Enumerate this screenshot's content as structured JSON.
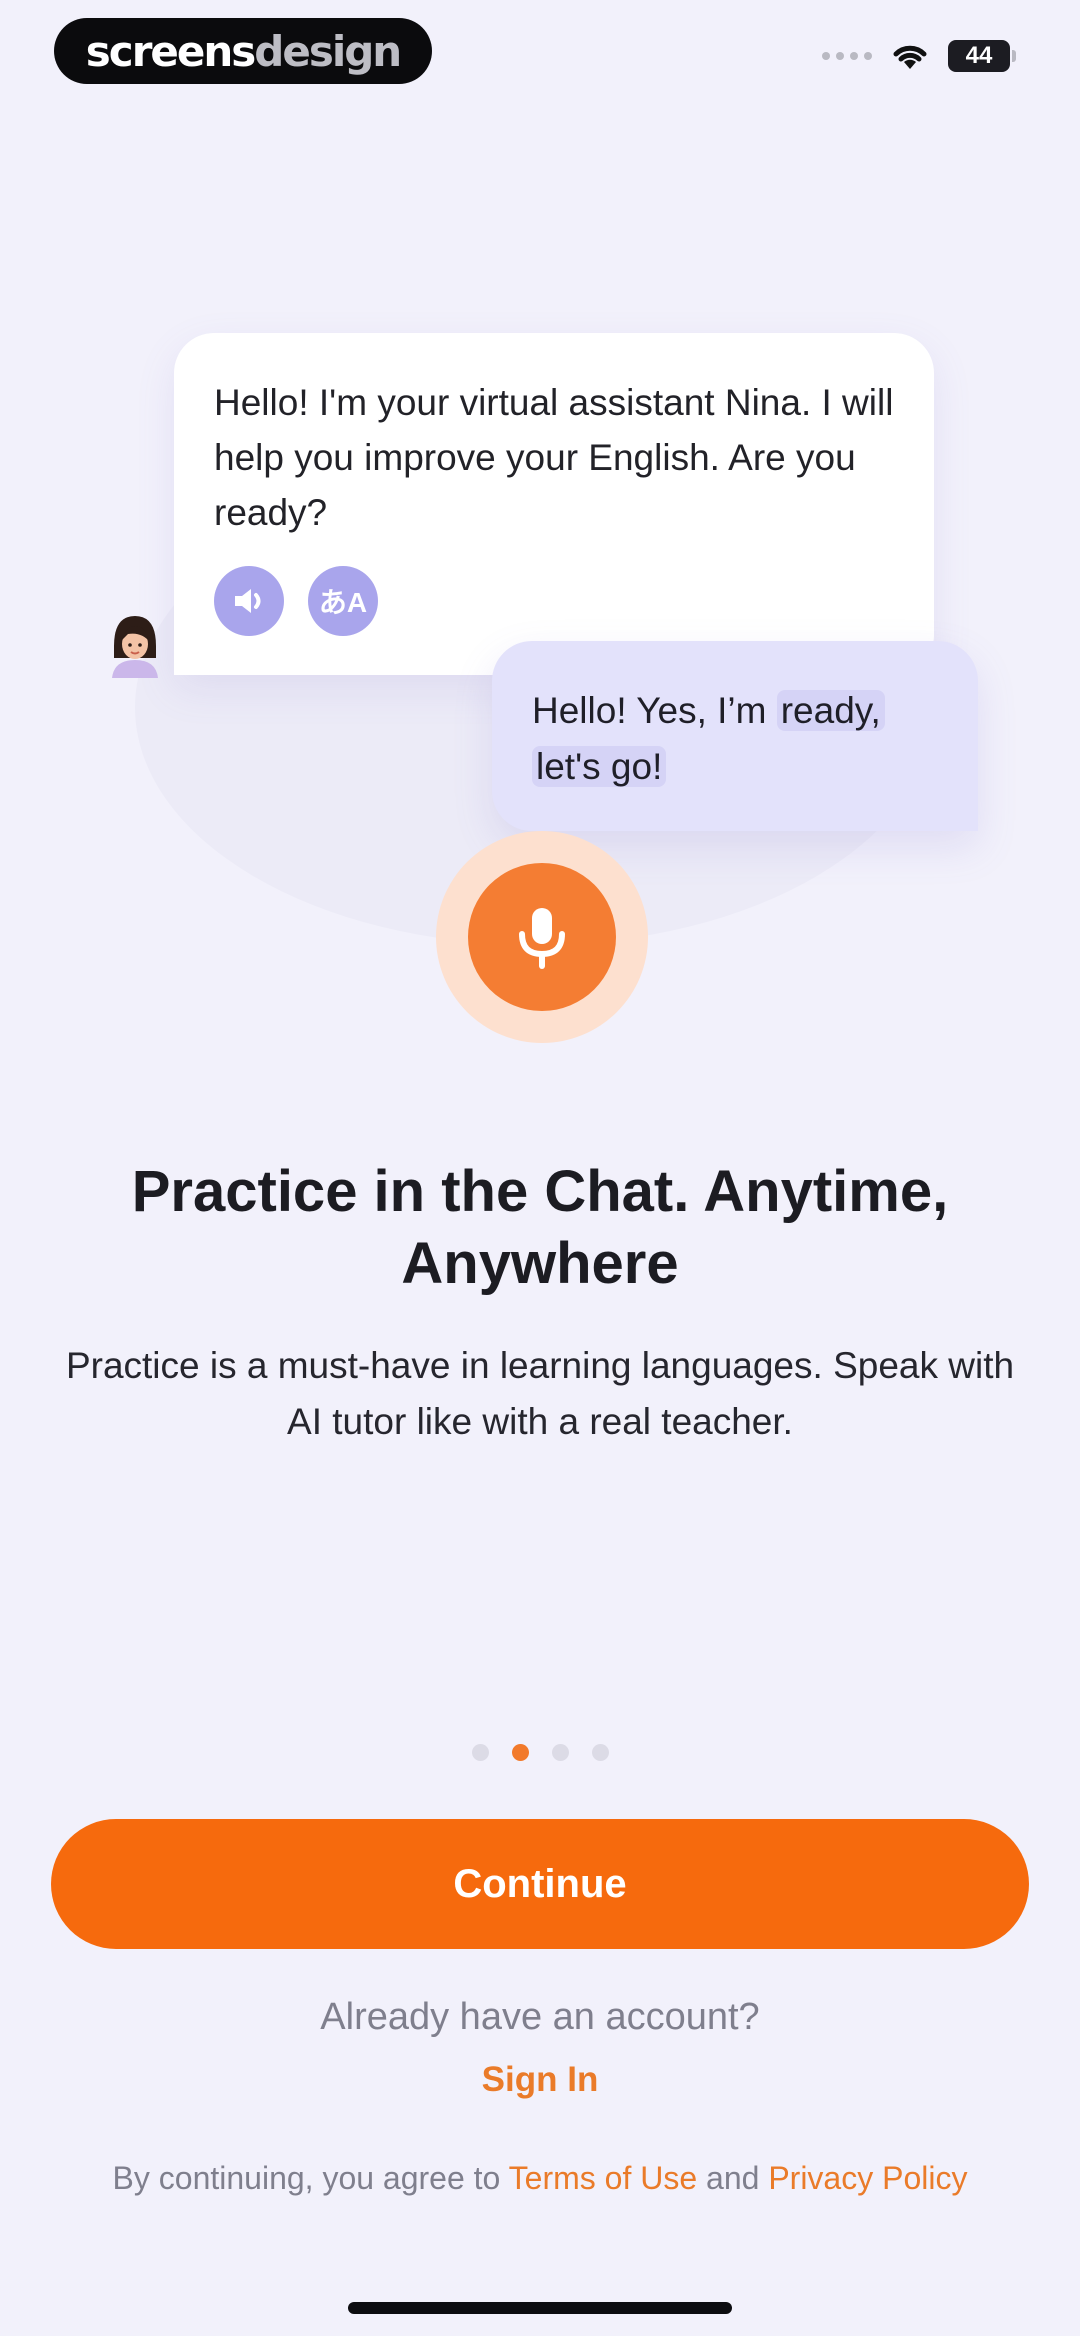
{
  "status_bar": {
    "watermark_main": "screens",
    "watermark_dim": "design",
    "battery": "44",
    "icons": [
      "signal-dots-icon",
      "wifi-icon",
      "battery-icon"
    ]
  },
  "chat": {
    "bot_message": "Hello! I'm your virtual assistant Nina. I will help you improve your English. Are you ready?",
    "user_message_pre": "Hello! Yes, I’m ",
    "user_message_hl1": "ready,",
    "user_message_hl2": "let's go!",
    "speaker_icon": "speaker-icon",
    "translate_icon": "translate-icon",
    "translate_glyph": "あA",
    "mic_icon": "microphone-icon"
  },
  "onboarding": {
    "title": "Practice in the Chat. Anytime, Anywhere",
    "subtitle": "Practice is a must-have in learning languages. Speak with AI tutor like with a real teacher.",
    "page_index": 2,
    "page_count": 4
  },
  "actions": {
    "continue_label": "Continue",
    "account_question": "Already have an account?",
    "sign_in_label": "Sign In",
    "legal_prefix": "By continuing, you agree to ",
    "terms_label": "Terms of Use",
    "legal_and": " and ",
    "privacy_label": "Privacy Policy"
  },
  "colors": {
    "accent": "#f66a0d",
    "assistant_accent": "#a9a5ec",
    "background": "#f2f1fb"
  }
}
